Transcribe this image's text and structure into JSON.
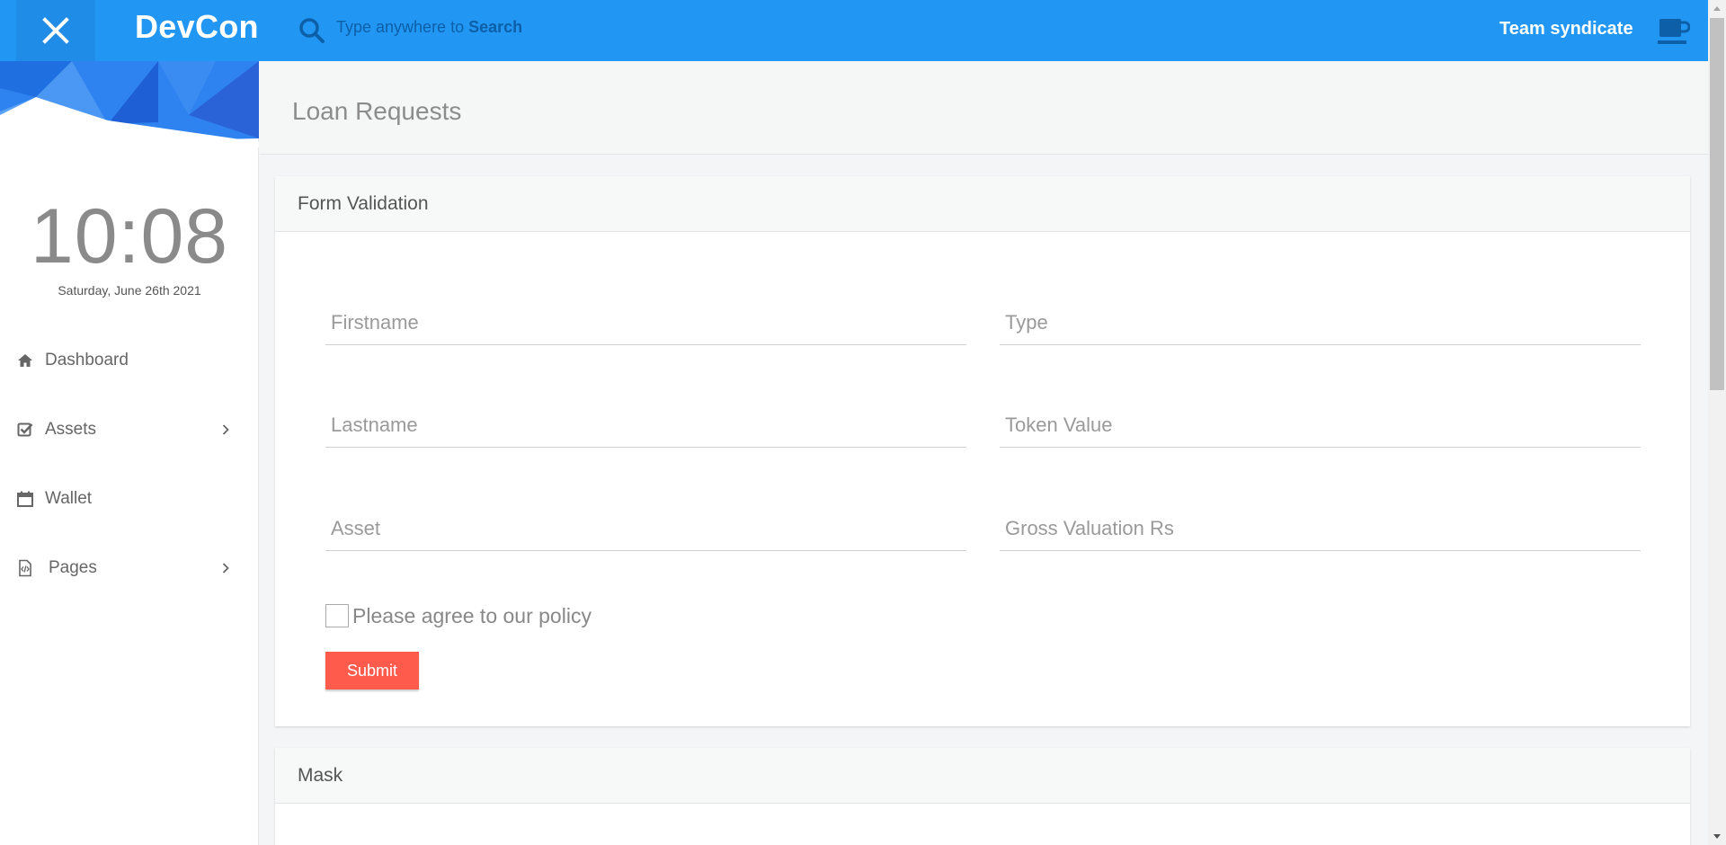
{
  "header": {
    "brand": "DevCon",
    "search_prefix": "Type anywhere to ",
    "search_keyword": "Search",
    "team_name": "Team syndicate"
  },
  "sidebar": {
    "clock": "10:08",
    "date": "Saturday, June 26th 2021",
    "items": [
      {
        "label": "Dashboard",
        "icon": "home-icon"
      },
      {
        "label": "Assets",
        "icon": "checkbox-icon",
        "has_submenu": true
      },
      {
        "label": "Wallet",
        "icon": "calendar-icon"
      },
      {
        "label": "Pages",
        "icon": "code-file-icon",
        "has_submenu": true
      }
    ]
  },
  "main": {
    "page_title": "Loan Requests",
    "form_card": {
      "title": "Form Validation",
      "fields": {
        "firstname": "Firstname",
        "type": "Type",
        "lastname": "Lastname",
        "token_value": "Token Value",
        "asset": "Asset",
        "gross_valuation": "Gross Valuation Rs"
      },
      "policy_label": "Please agree to our policy",
      "policy_checked": false,
      "submit_label": "Submit"
    },
    "mask_card": {
      "title": "Mask"
    }
  },
  "colors": {
    "topbar": "#2196f3",
    "accent_button": "#ff5b4c"
  }
}
